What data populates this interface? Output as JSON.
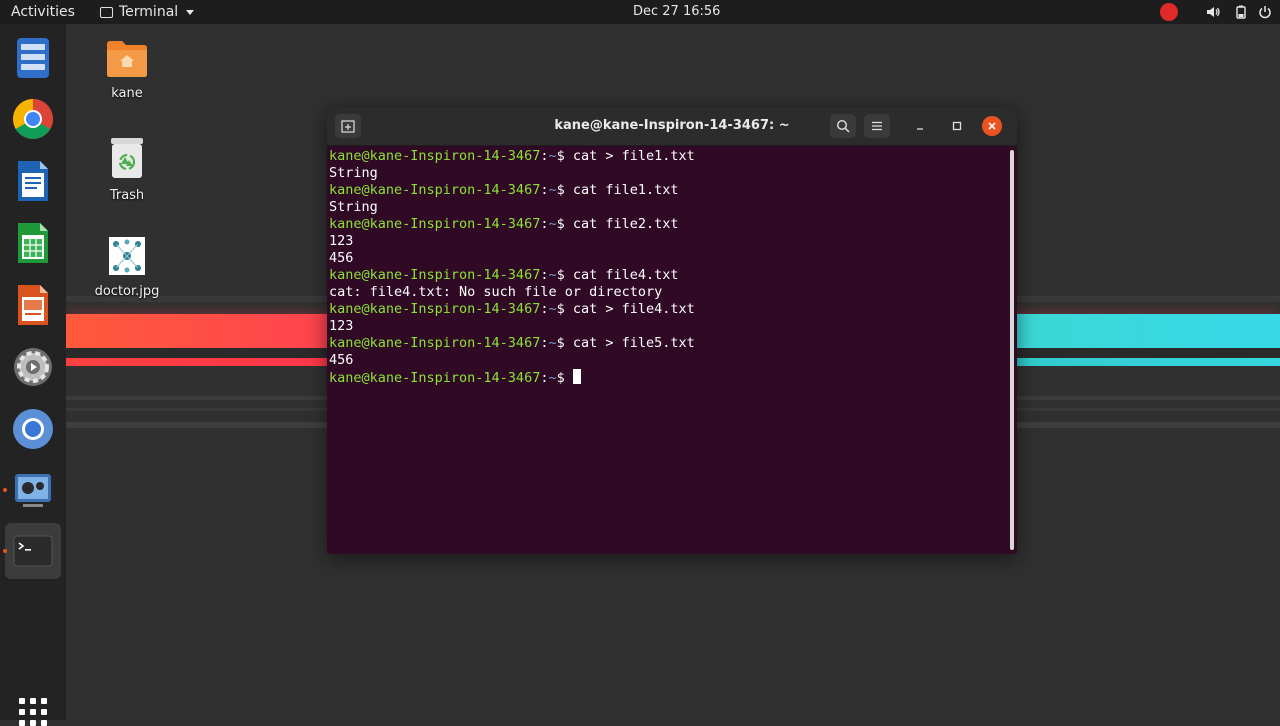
{
  "topbar": {
    "activities": "Activities",
    "app_name": "Terminal",
    "clock": "Dec 27  16:56"
  },
  "desktop": {
    "icons": [
      {
        "label": "kane"
      },
      {
        "label": "Trash"
      },
      {
        "label": "doctor.jpg"
      }
    ]
  },
  "terminal": {
    "title": "kane@kane-Inspiron-14-3467: ~",
    "prompt_user": "kane@kane-Inspiron-14-3467",
    "prompt_path": "~",
    "lines": [
      {
        "type": "cmd",
        "text": " cat > file1.txt"
      },
      {
        "type": "out",
        "text": "String"
      },
      {
        "type": "cmd",
        "text": " cat file1.txt"
      },
      {
        "type": "out",
        "text": "String"
      },
      {
        "type": "cmd",
        "text": " cat file2.txt"
      },
      {
        "type": "out",
        "text": "123"
      },
      {
        "type": "out",
        "text": "456"
      },
      {
        "type": "cmd",
        "text": " cat file4.txt"
      },
      {
        "type": "out",
        "text": "cat: file4.txt: No such file or directory"
      },
      {
        "type": "cmd",
        "text": " cat > file4.txt"
      },
      {
        "type": "out",
        "text": "123"
      },
      {
        "type": "cmd",
        "text": " cat > file5.txt"
      },
      {
        "type": "out",
        "text": "456"
      },
      {
        "type": "cmd",
        "text": " "
      }
    ]
  },
  "colors": {
    "terminal_bg": "#300a24",
    "prompt_green": "#8ae234",
    "path_blue": "#729fcf",
    "accent_orange": "#e95420"
  },
  "dock": {
    "items": [
      "files-icon",
      "chrome-icon",
      "writer-icon",
      "calc-icon",
      "impress-icon",
      "settings-icon",
      "chromium-icon",
      "video-app-icon",
      "terminal-icon"
    ]
  }
}
